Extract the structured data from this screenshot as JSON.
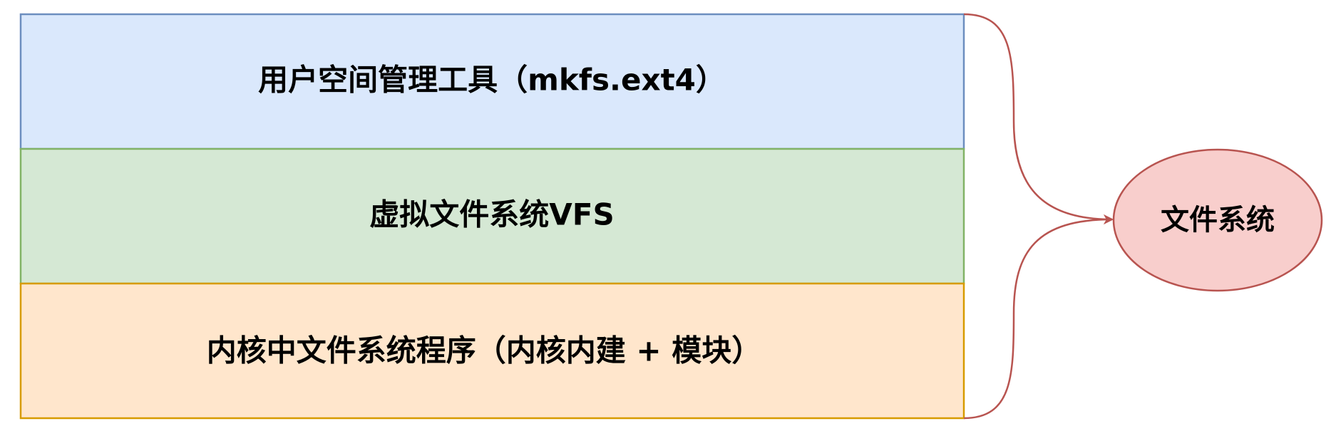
{
  "layers": [
    {
      "label": "用户空间管理工具（mkfs.ext4）",
      "fill": "#dae8fc",
      "stroke": "#6c8ebf"
    },
    {
      "label": "虚拟文件系统VFS",
      "fill": "#d5e8d4",
      "stroke": "#82b366"
    },
    {
      "label": "内核中文件系统程序（内核内建 + 模块）",
      "fill": "#ffe6cc",
      "stroke": "#d79b00"
    }
  ],
  "target": {
    "label": "文件系统",
    "fill": "#f8cecc",
    "stroke": "#b85450"
  },
  "connector_color": "#b85450"
}
